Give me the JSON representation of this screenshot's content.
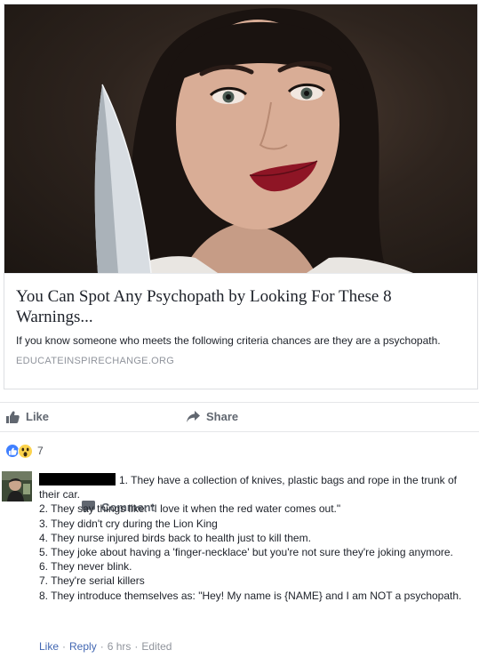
{
  "post": {
    "headline": "You Can Spot Any Psychopath by Looking For These 8 Warnings...",
    "description": "If you know someone who meets the following criteria chances are they are a psychopath.",
    "domain": "EDUCATEINSPIRECHANGE.ORG"
  },
  "actions": {
    "like_label": "Like",
    "comment_label": "Comment",
    "share_label": "Share"
  },
  "reactions": {
    "count": "7",
    "types": [
      "like-icon",
      "wow-icon"
    ]
  },
  "comment": {
    "first_line": "1. They have a collection of knives, plastic bags and rope in the trunk of their car.",
    "lines": [
      "2. They say things like: \"I love it when the red water comes out.\"",
      "3. They didn't cry during the Lion King",
      "4. They nurse injured birds back to health just to kill them.",
      "5. They joke about having a 'finger-necklace' but you're not sure they're joking anymore.",
      "6. They never blink.",
      "7. They're serial killers",
      "8. They introduce themselves as: \"Hey! My name is {NAME} and I am NOT a psychopath."
    ],
    "like_label": "Like",
    "reply_label": "Reply",
    "time": "6 hrs",
    "edited": "Edited"
  },
  "colors": {
    "link": "#4267b2",
    "meta": "#90949c",
    "action": "#616770",
    "like_blue": "#4080ff",
    "border": "#dddfe2"
  }
}
